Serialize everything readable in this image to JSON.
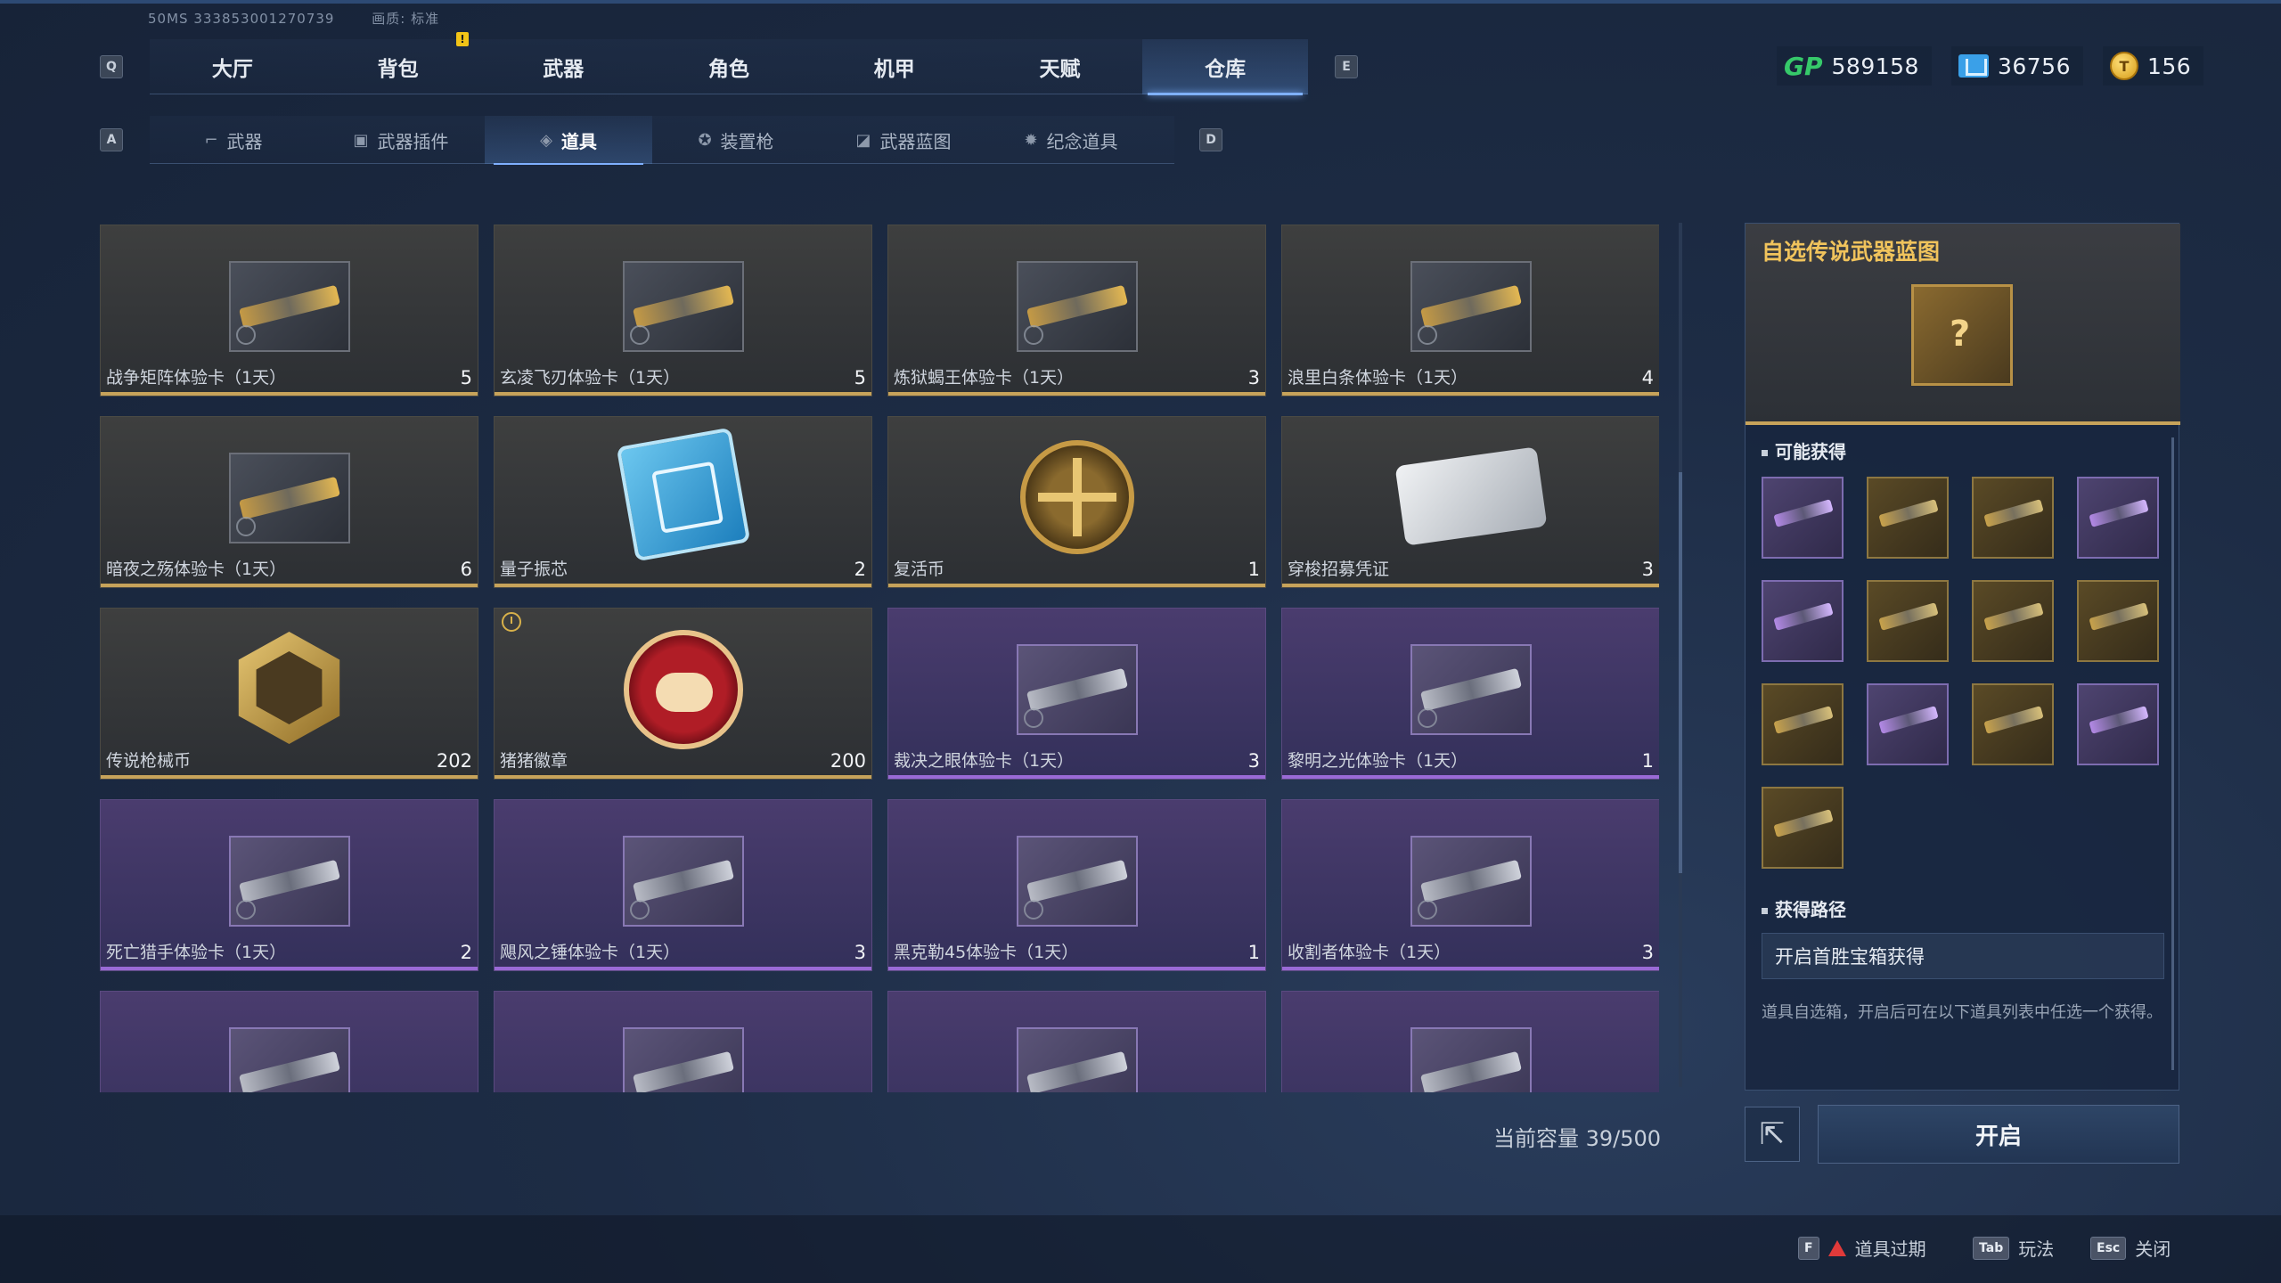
{
  "build": {
    "id": "50MS 333853001270739",
    "quality": "画质: 标准"
  },
  "main_tabs": {
    "key_left": "Q",
    "key_right": "E",
    "items": [
      {
        "label": "大厅"
      },
      {
        "label": "背包"
      },
      {
        "label": "武器"
      },
      {
        "label": "角色"
      },
      {
        "label": "机甲"
      },
      {
        "label": "天赋"
      },
      {
        "label": "仓库"
      }
    ],
    "active": "仓库",
    "notification": "!"
  },
  "currencies": [
    {
      "icon": "gp-icon",
      "label": "GP",
      "value": "589158"
    },
    {
      "icon": "card-currency-icon",
      "value": "36756"
    },
    {
      "icon": "gold-coin-icon",
      "value": "156"
    }
  ],
  "sub_tabs": {
    "key_left": "A",
    "key_right": "D",
    "items": [
      {
        "label": "武器",
        "icon": "rifle-icon"
      },
      {
        "label": "武器插件",
        "icon": "attachment-icon"
      },
      {
        "label": "道具",
        "icon": "item-tag-icon"
      },
      {
        "label": "装置枪",
        "icon": "device-gun-icon"
      },
      {
        "label": "武器蓝图",
        "icon": "blueprint-icon"
      },
      {
        "label": "纪念道具",
        "icon": "medal-icon"
      }
    ],
    "active": "道具"
  },
  "items": [
    {
      "name": "战争矩阵体验卡（1天）",
      "count": "5",
      "rarity": "gold",
      "art": "gun"
    },
    {
      "name": "玄凌飞刃体验卡（1天）",
      "count": "5",
      "rarity": "gold",
      "art": "gun"
    },
    {
      "name": "炼狱蝎王体验卡（1天）",
      "count": "3",
      "rarity": "gold",
      "art": "gun"
    },
    {
      "name": "浪里白条体验卡（1天）",
      "count": "4",
      "rarity": "gold",
      "art": "gun"
    },
    {
      "name": "暗夜之殇体验卡（1天）",
      "count": "6",
      "rarity": "gold",
      "art": "gun"
    },
    {
      "name": "量子振芯",
      "count": "2",
      "rarity": "gold",
      "art": "chip"
    },
    {
      "name": "复活币",
      "count": "1",
      "rarity": "gold",
      "art": "revive-coin"
    },
    {
      "name": "穿梭招募凭证",
      "count": "3",
      "rarity": "gold",
      "art": "ticket"
    },
    {
      "name": "传说枪械币",
      "count": "202",
      "rarity": "gold",
      "art": "hex-coin"
    },
    {
      "name": "猪猪徽章",
      "count": "200",
      "rarity": "gold",
      "art": "pig",
      "timed": true
    },
    {
      "name": "裁决之眼体验卡（1天）",
      "count": "3",
      "rarity": "purple",
      "art": "gun"
    },
    {
      "name": "黎明之光体验卡（1天）",
      "count": "1",
      "rarity": "purple",
      "art": "gun"
    },
    {
      "name": "死亡猎手体验卡（1天）",
      "count": "2",
      "rarity": "purple",
      "art": "gun"
    },
    {
      "name": "飓风之锤体验卡（1天）",
      "count": "3",
      "rarity": "purple",
      "art": "gun"
    },
    {
      "name": "黑克勒45体验卡（1天）",
      "count": "1",
      "rarity": "purple",
      "art": "gun"
    },
    {
      "name": "收割者体验卡（1天）",
      "count": "3",
      "rarity": "purple",
      "art": "gun"
    },
    {
      "name": "",
      "count": "",
      "rarity": "purple",
      "art": "gun"
    },
    {
      "name": "",
      "count": "",
      "rarity": "purple",
      "art": "gun"
    },
    {
      "name": "",
      "count": "",
      "rarity": "purple",
      "art": "gun"
    },
    {
      "name": "",
      "count": "",
      "rarity": "purple",
      "art": "gun"
    }
  ],
  "capacity": "当前容量 39/500",
  "detail": {
    "title": "自选传说武器蓝图",
    "possible_title": "可能获得",
    "possible": [
      "purple",
      "gold",
      "gold",
      "purple",
      "purple",
      "gold",
      "gold",
      "gold",
      "gold",
      "purple",
      "gold",
      "purple",
      "gold"
    ],
    "route_title": "获得路径",
    "route": "开启首胜宝箱获得",
    "description": "道具自选箱，开启后可在以下道具列表中任选一个获得。",
    "open_button": "开启"
  },
  "hints": [
    {
      "key": "F",
      "label": "道具过期"
    },
    {
      "key": "Tab",
      "label": "玩法"
    },
    {
      "key": "Esc",
      "label": "关闭"
    }
  ],
  "colors": {
    "gold": "#c7a35a",
    "purple": "#9a6ad6",
    "accent": "#7fb0ff",
    "title_gold": "#f0c35c"
  }
}
